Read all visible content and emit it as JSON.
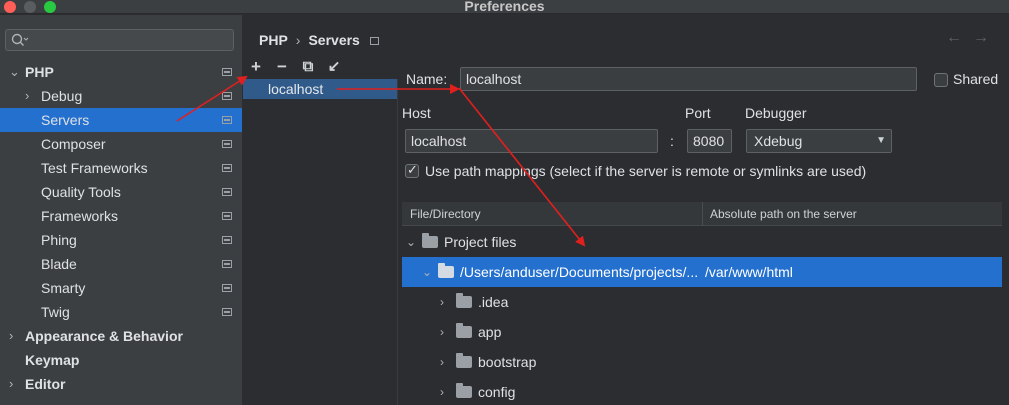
{
  "window": {
    "title": "Preferences"
  },
  "search": {
    "placeholder": "",
    "icon": "search-icon"
  },
  "sidebar": {
    "items": [
      {
        "label": "PHP",
        "level": 0,
        "arrow": "⌄",
        "bold": true,
        "selected": false,
        "project_icon": true
      },
      {
        "label": "Debug",
        "level": 1,
        "arrow": "›",
        "bold": false,
        "selected": false,
        "project_icon": true
      },
      {
        "label": "Servers",
        "level": 1,
        "arrow": "",
        "bold": false,
        "selected": true,
        "project_icon": true
      },
      {
        "label": "Composer",
        "level": 1,
        "arrow": "",
        "bold": false,
        "selected": false,
        "project_icon": true
      },
      {
        "label": "Test Frameworks",
        "level": 1,
        "arrow": "",
        "bold": false,
        "selected": false,
        "project_icon": true
      },
      {
        "label": "Quality Tools",
        "level": 1,
        "arrow": "",
        "bold": false,
        "selected": false,
        "project_icon": true
      },
      {
        "label": "Frameworks",
        "level": 1,
        "arrow": "",
        "bold": false,
        "selected": false,
        "project_icon": true
      },
      {
        "label": "Phing",
        "level": 1,
        "arrow": "",
        "bold": false,
        "selected": false,
        "project_icon": true
      },
      {
        "label": "Blade",
        "level": 1,
        "arrow": "",
        "bold": false,
        "selected": false,
        "project_icon": true
      },
      {
        "label": "Smarty",
        "level": 1,
        "arrow": "",
        "bold": false,
        "selected": false,
        "project_icon": true
      },
      {
        "label": "Twig",
        "level": 1,
        "arrow": "",
        "bold": false,
        "selected": false,
        "project_icon": true
      },
      {
        "label": "Appearance & Behavior",
        "level": 0,
        "arrow": "›",
        "bold": true,
        "selected": false,
        "project_icon": false
      },
      {
        "label": "Keymap",
        "level": 0,
        "arrow": "",
        "bold": true,
        "selected": false,
        "project_icon": false
      },
      {
        "label": "Editor",
        "level": 0,
        "arrow": "›",
        "bold": true,
        "selected": false,
        "project_icon": false
      }
    ]
  },
  "breadcrumb": {
    "parent": "PHP",
    "separator": "›",
    "current": "Servers"
  },
  "nav": {
    "back": "←",
    "forward": "→"
  },
  "toolbar": {
    "add": "+",
    "remove": "−",
    "copy": "⧉",
    "import": "↙"
  },
  "servers": {
    "items": [
      {
        "label": "localhost"
      }
    ]
  },
  "form": {
    "name_label": "Name:",
    "name_value": "localhost",
    "shared_label": "Shared",
    "shared_checked": false,
    "host_label": "Host",
    "host_value": "localhost",
    "port_separator": ":",
    "port_label": "Port",
    "port_value": "8080",
    "debugger_label": "Debugger",
    "debugger_value": "Xdebug",
    "use_mappings_label": "Use path mappings (select if the server is remote or symlinks are used)",
    "use_mappings_checked": true
  },
  "mappings": {
    "col_file": "File/Directory",
    "col_abs": "Absolute path on the server",
    "rows": [
      {
        "label": "Project files",
        "server_path": "",
        "indent": 0,
        "arrow": "⌄",
        "selected": false
      },
      {
        "label": "/Users/anduser/Documents/projects/...",
        "server_path": "/var/www/html",
        "indent": 1,
        "arrow": "⌄",
        "selected": true
      },
      {
        "label": ".idea",
        "server_path": "",
        "indent": 2,
        "arrow": "›",
        "selected": false
      },
      {
        "label": "app",
        "server_path": "",
        "indent": 2,
        "arrow": "›",
        "selected": false
      },
      {
        "label": "bootstrap",
        "server_path": "",
        "indent": 2,
        "arrow": "›",
        "selected": false
      },
      {
        "label": "config",
        "server_path": "",
        "indent": 2,
        "arrow": "›",
        "selected": false
      }
    ]
  },
  "colors": {
    "selection": "#2470cf",
    "annotation_arrow": "#e0201e",
    "sidebar_bg": "#3b3f42",
    "panel_bg": "#2b2d30"
  }
}
